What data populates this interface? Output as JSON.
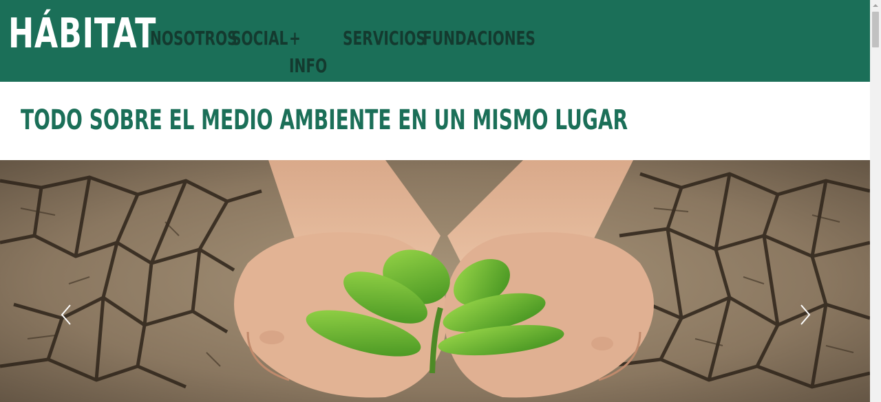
{
  "header": {
    "logo": "HÁBITAT",
    "nav": [
      {
        "label": "NOSOTROS"
      },
      {
        "label": "SOCIAL"
      },
      {
        "label": "+ INFO"
      },
      {
        "label": "SERVICIOS"
      },
      {
        "label": "FUNDACIONES"
      }
    ]
  },
  "tagline": "TODO SOBRE EL MEDIO AMBIENTE EN UN MISMO LUGAR",
  "carousel": {
    "slide_image": "hands-holding-seedling-on-cracked-earth",
    "prev_icon": "chevron-left-icon",
    "next_icon": "chevron-right-icon"
  },
  "colors": {
    "header_bg": "#1b6f58",
    "nav_text": "#143a2f",
    "tagline_text": "#1b6f58",
    "logo_text": "#ffffff"
  }
}
